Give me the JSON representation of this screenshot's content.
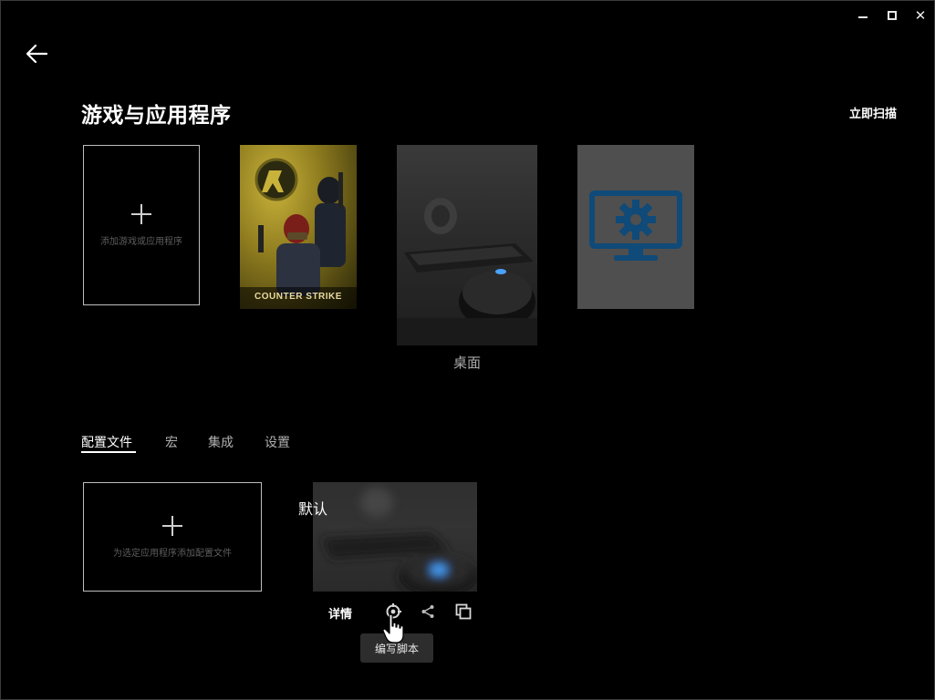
{
  "window": {
    "controls": {
      "minimize": "minimize",
      "maximize": "maximize",
      "close": "✕"
    }
  },
  "header": {
    "title": "游戏与应用程序",
    "scan_label": "立即扫描"
  },
  "games": {
    "add_label": "添加游戏或应用程序",
    "tiles": [
      {
        "name": "counter-strike",
        "logo_text": "COUNTER STRIKE"
      },
      {
        "name": "desktop",
        "label": "桌面"
      },
      {
        "name": "settings-app"
      }
    ]
  },
  "tabs": [
    {
      "label": "配置文件",
      "active": true
    },
    {
      "label": "宏",
      "active": false
    },
    {
      "label": "集成",
      "active": false
    },
    {
      "label": "设置",
      "active": false
    }
  ],
  "profiles": {
    "add_label": "为选定应用程序添加配置文件",
    "items": [
      {
        "name": "默认"
      }
    ]
  },
  "profile_actions": {
    "details_label": "详情",
    "tooltip": "编写脚本"
  },
  "colors": {
    "background": "#000000",
    "accent_blue": "#4aa3ff",
    "settings_tile": "#4f4f4f",
    "settings_icon": "#0f4a78"
  }
}
